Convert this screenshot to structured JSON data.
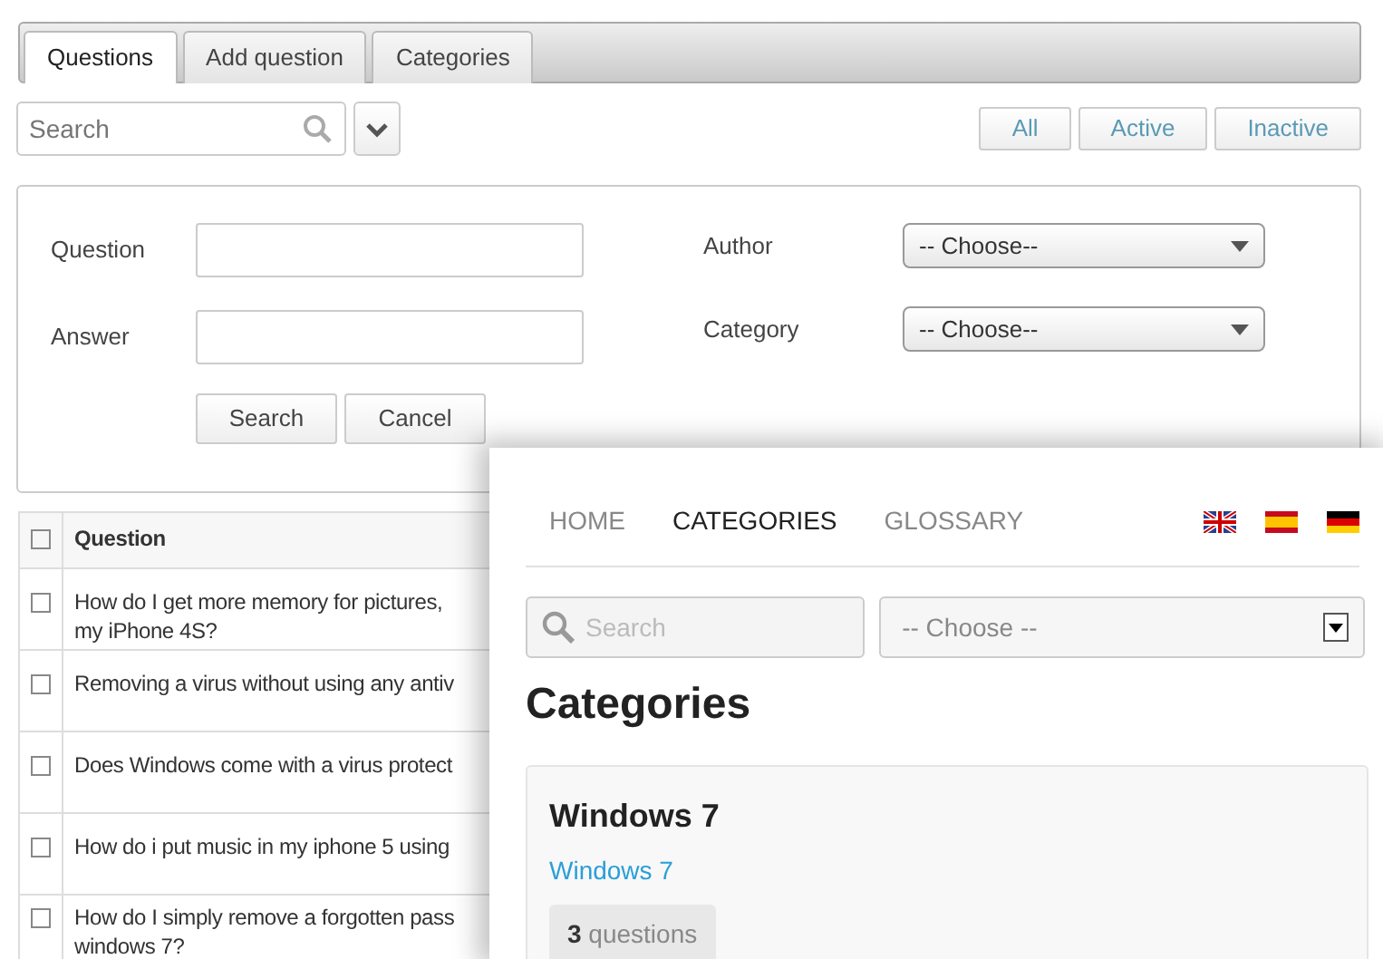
{
  "tabs": [
    {
      "label": "Questions",
      "selected": true
    },
    {
      "label": "Add question",
      "selected": false
    },
    {
      "label": "Categories",
      "selected": false
    }
  ],
  "search": {
    "placeholder": "Search"
  },
  "filters": [
    {
      "label": "All",
      "selected": false
    },
    {
      "label": "Active",
      "selected": false
    },
    {
      "label": "Inactive",
      "selected": false
    }
  ],
  "search_form": {
    "question_label": "Question",
    "answer_label": "Answer",
    "author_label": "Author",
    "author_value": "-- Choose--",
    "category_label": "Category",
    "category_value": "-- Choose--",
    "buttons": [
      "Search",
      "Cancel"
    ]
  },
  "table": {
    "header_checked": false,
    "columns": [
      "Question"
    ],
    "rows": [
      {
        "checked": false,
        "lines": [
          "How do I get more memory for pictures,",
          "my iPhone 4S?"
        ]
      },
      {
        "checked": false,
        "lines": [
          "Removing a virus without using any antiv"
        ]
      },
      {
        "checked": false,
        "lines": [
          "Does Windows come with a virus protect"
        ]
      },
      {
        "checked": false,
        "lines": [
          "How do i put music in my iphone 5 using"
        ]
      },
      {
        "checked": false,
        "lines": [
          "How do I simply remove a forgotten pass",
          "windows 7?"
        ]
      }
    ]
  },
  "frontend": {
    "nav": [
      {
        "label": "HOME",
        "selected": false
      },
      {
        "label": "CATEGORIES",
        "selected": true
      },
      {
        "label": "GLOSSARY",
        "selected": false
      }
    ],
    "flags": [
      {
        "kind": "uk"
      },
      {
        "kind": "es"
      },
      {
        "kind": "de"
      }
    ],
    "search": {
      "placeholder": "Search"
    },
    "select": {
      "value": "-- Choose --"
    },
    "heading": "Categories",
    "categories": [
      {
        "title": "Windows 7",
        "link": "Windows 7",
        "count": "3",
        "count_label": "questions"
      }
    ]
  }
}
